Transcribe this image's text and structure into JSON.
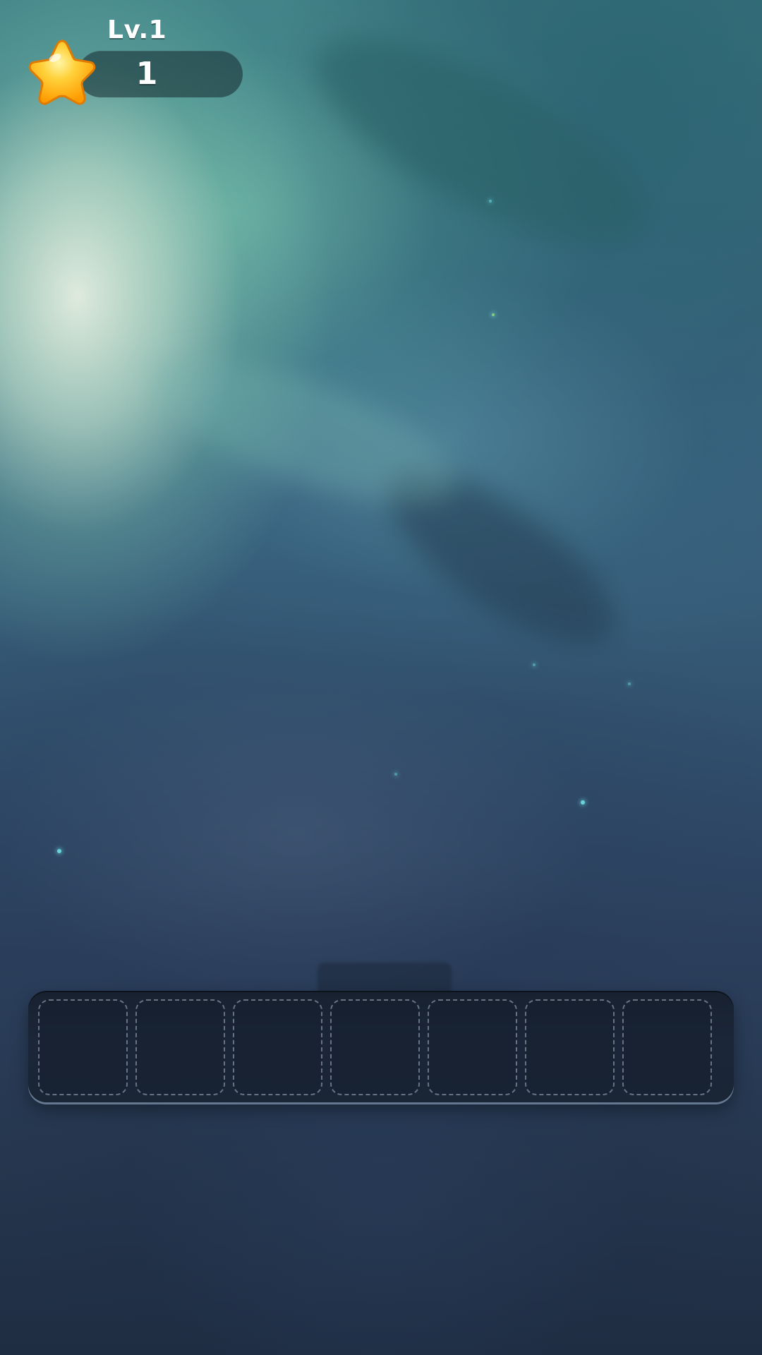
{
  "hud": {
    "level_label": "Lv.1",
    "score": "1",
    "star_icon": "star-icon"
  },
  "tray": {
    "slot_count": 7,
    "slots": [
      "",
      "",
      "",
      "",
      "",
      "",
      ""
    ]
  },
  "colors": {
    "star": "#ffb400",
    "tray_bg": "#1b2638",
    "tray_border": "#a0b9d7",
    "slot_dash": "#aab9c8"
  }
}
